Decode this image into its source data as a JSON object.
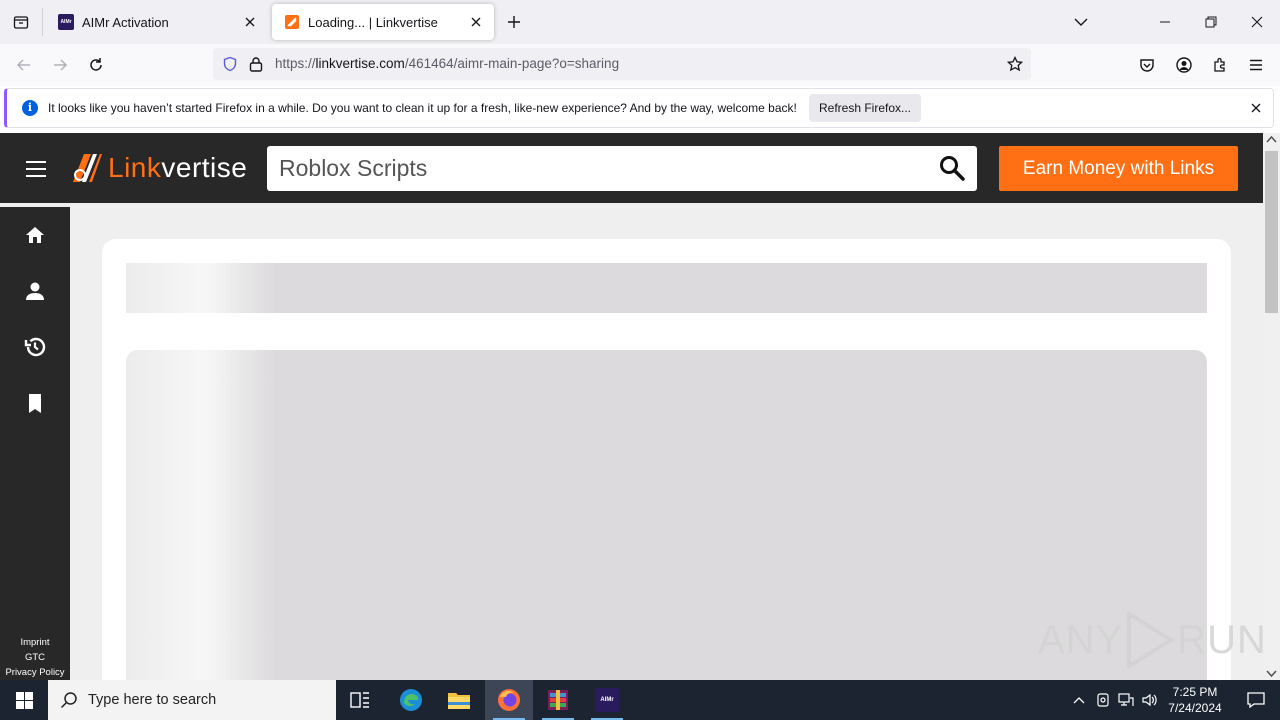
{
  "browser": {
    "tabs": [
      {
        "title": "AIMr Activation",
        "favicon_text": "AIMr",
        "active": false
      },
      {
        "title": "Loading... | Linkvertise",
        "active": true
      }
    ],
    "url": {
      "scheme": "https://",
      "host": "linkvertise.com",
      "path": "/461464/aimr-main-page?o=sharing"
    },
    "notification": {
      "text": "It looks like you haven’t started Firefox in a while. Do you want to clean it up for a fresh, like-new experience? And by the way, welcome back!",
      "button_label": "Refresh Firefox..."
    }
  },
  "site": {
    "logo_link": "Link",
    "logo_rest": "vertise",
    "search": {
      "value": "Roblox Scripts"
    },
    "earn_button": "Earn Money with Links",
    "sidebar_icons": [
      "home-icon",
      "user-icon",
      "history-icon",
      "bookmark-icon"
    ],
    "footer_links": [
      "Imprint",
      "GTC",
      "Privacy Policy"
    ],
    "brand_color": "#ff6f14",
    "dark_color": "#282828"
  },
  "watermark": {
    "left": "ANY",
    "right": "RUN"
  },
  "taskbar": {
    "search_placeholder": "Type here to search",
    "apps": [
      "task-view-icon",
      "edge-icon",
      "file-explorer-icon",
      "firefox-icon",
      "winrar-icon",
      "aimr-icon"
    ],
    "aimr_label": "AIMr",
    "time": "7:25 PM",
    "date": "7/24/2024"
  }
}
